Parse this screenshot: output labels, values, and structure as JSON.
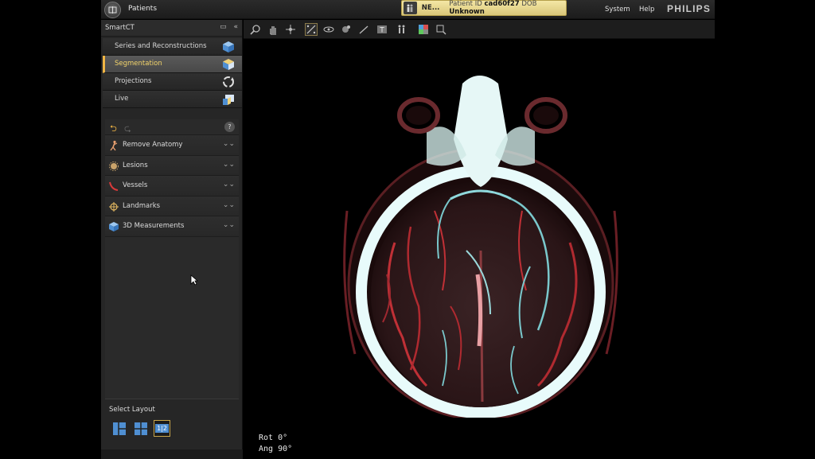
{
  "topbar": {
    "patients_label": "Patients",
    "patient_name": "NE...",
    "patient_id_label": "Patient ID",
    "patient_id_value": "cad60f27",
    "dob_label": "DOB",
    "dob_value": "Unknown",
    "menu_system": "System",
    "menu_help": "Help",
    "brand": "PHILIPS"
  },
  "panel": {
    "title": "SmartCT",
    "nav": [
      {
        "label": "Series and Reconstructions",
        "icon": "cube-stack-icon"
      },
      {
        "label": "Segmentation",
        "icon": "cube-segment-icon",
        "active": true
      },
      {
        "label": "Projections",
        "icon": "rotate-arrows-icon"
      },
      {
        "label": "Live",
        "icon": "live-cube-icon"
      }
    ],
    "tools": [
      {
        "label": "Remove Anatomy",
        "icon": "figure-icon"
      },
      {
        "label": "Lesions",
        "icon": "lesion-icon"
      },
      {
        "label": "Vessels",
        "icon": "vessel-icon"
      },
      {
        "label": "Landmarks",
        "icon": "crosshair-icon"
      },
      {
        "label": "3D Measurements",
        "icon": "cube-measure-icon"
      }
    ],
    "help_glyph": "?",
    "layout_title": "Select Layout",
    "layout_selected_label": "1|2"
  },
  "viewer": {
    "rot_label": "Rot  0°",
    "ang_label": "Ang  90°"
  },
  "colors": {
    "accent": "#f0b544",
    "patient_box": "#efdf98",
    "active_nav_text": "#f3d46a"
  }
}
